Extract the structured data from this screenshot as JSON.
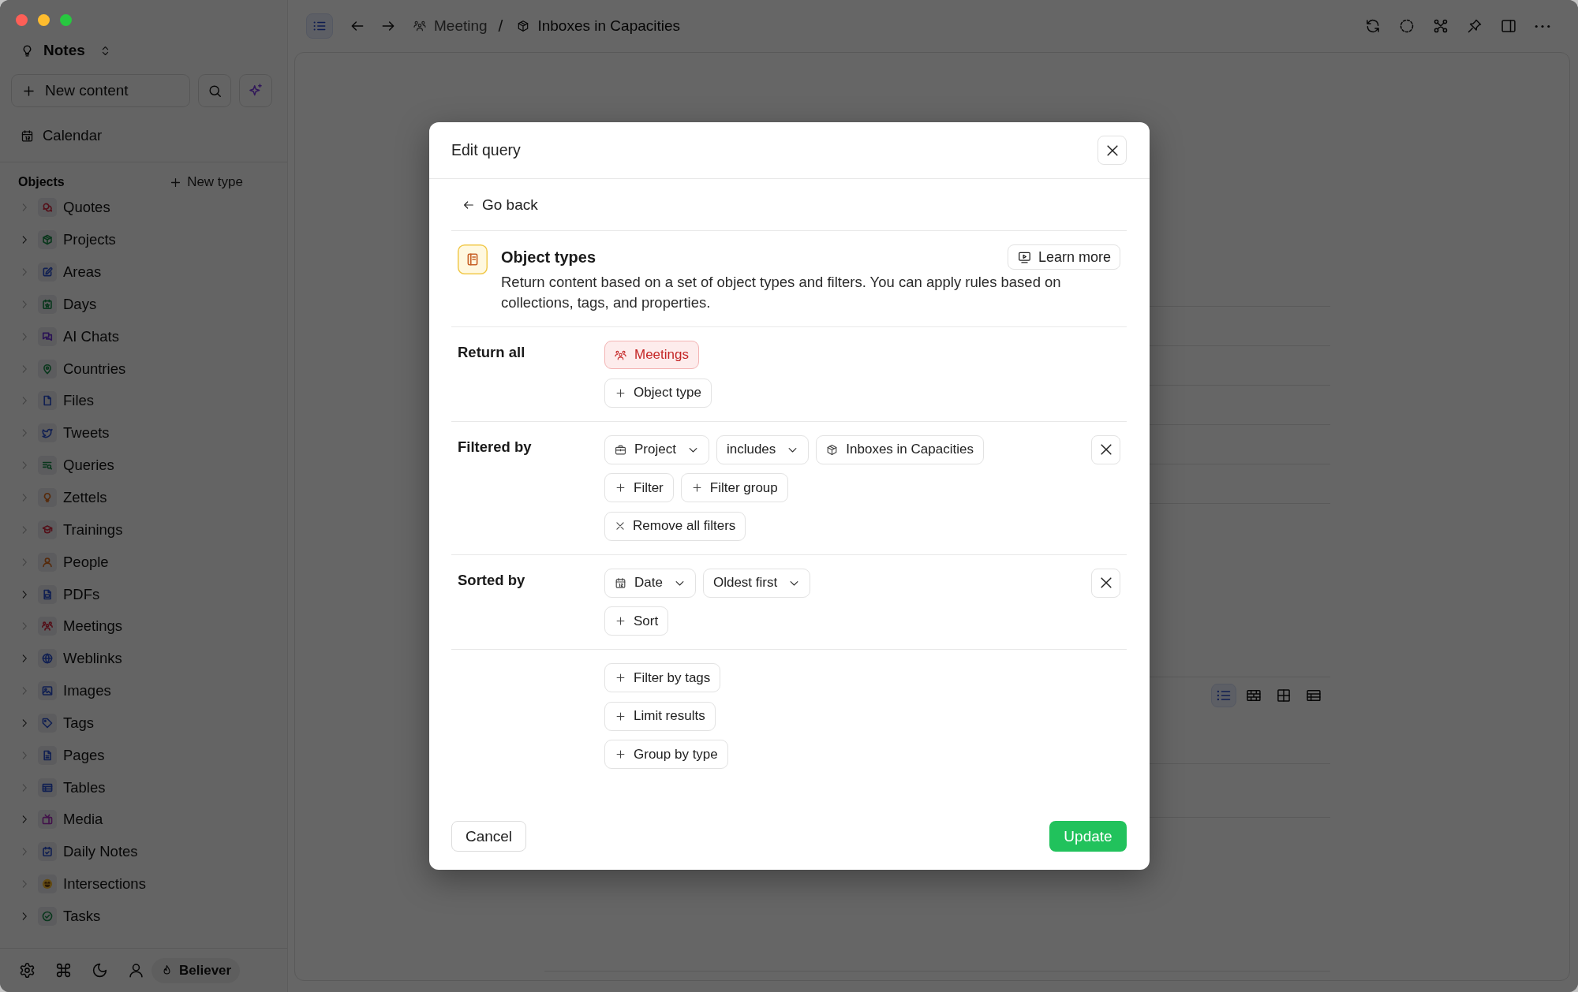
{
  "sidebar": {
    "space": {
      "name": "Notes"
    },
    "new_content": "New content",
    "calendar": "Calendar",
    "objects": {
      "heading": "Objects",
      "new_type": "New type",
      "items": [
        {
          "label": "Quotes",
          "expandable": false
        },
        {
          "label": "Projects",
          "expandable": true
        },
        {
          "label": "Areas",
          "expandable": false
        },
        {
          "label": "Days",
          "expandable": false
        },
        {
          "label": "AI Chats",
          "expandable": false
        },
        {
          "label": "Countries",
          "expandable": false
        },
        {
          "label": "Files",
          "expandable": false
        },
        {
          "label": "Tweets",
          "expandable": false
        },
        {
          "label": "Queries",
          "expandable": false
        },
        {
          "label": "Zettels",
          "expandable": false
        },
        {
          "label": "Trainings",
          "expandable": false
        },
        {
          "label": "People",
          "expandable": false
        },
        {
          "label": "PDFs",
          "expandable": true
        },
        {
          "label": "Meetings",
          "expandable": false
        },
        {
          "label": "Weblinks",
          "expandable": true
        },
        {
          "label": "Images",
          "expandable": false
        },
        {
          "label": "Tags",
          "expandable": true
        },
        {
          "label": "Pages",
          "expandable": false
        },
        {
          "label": "Tables",
          "expandable": false
        },
        {
          "label": "Media",
          "expandable": true
        },
        {
          "label": "Daily Notes",
          "expandable": false
        },
        {
          "label": "Intersections",
          "expandable": false
        },
        {
          "label": "Tasks",
          "expandable": true
        }
      ]
    },
    "footer": {
      "plan": "Believer"
    }
  },
  "toolbar": {
    "sidebar_toggle": {
      "on": true
    },
    "breadcrumbs": [
      {
        "label": "Meeting",
        "current": false
      },
      {
        "label": "Inboxes in Capacities",
        "current": true
      }
    ],
    "separator": "/"
  },
  "content": {
    "views": [
      {
        "selected": true
      },
      {
        "selected": false
      },
      {
        "selected": false
      },
      {
        "selected": false
      }
    ]
  },
  "dialog": {
    "title": "Edit query",
    "back": "Go back",
    "intro": {
      "title": "Object types",
      "description": "Return content based on a set of object types and filters. You can apply rules based on collections, tags, and properties.",
      "learn_more": "Learn more"
    },
    "sections": [
      {
        "label": "Return all",
        "removable": false,
        "rows": [
          [
            {
              "kind": "type",
              "label": "Meetings"
            }
          ],
          [
            {
              "kind": "add",
              "label": "Object type"
            }
          ]
        ]
      },
      {
        "label": "Filtered by",
        "removable": true,
        "rows": [
          [
            {
              "kind": "relation_property",
              "label": "Project"
            },
            {
              "kind": "select",
              "label": "includes"
            },
            {
              "kind": "value",
              "label": "Inboxes in Capacities"
            }
          ],
          [
            {
              "kind": "add",
              "label": "Filter"
            },
            {
              "kind": "add",
              "label": "Filter group"
            }
          ],
          [
            {
              "kind": "clear",
              "label": "Remove all filters"
            }
          ]
        ]
      },
      {
        "label": "Sorted by",
        "removable": true,
        "rows": [
          [
            {
              "kind": "date_property",
              "label": "Date"
            },
            {
              "kind": "select",
              "label": "Oldest first"
            }
          ],
          [
            {
              "kind": "add",
              "label": "Sort"
            }
          ]
        ]
      },
      {
        "removable": false,
        "rows": [
          [
            {
              "kind": "add",
              "label": "Filter by tags"
            }
          ],
          [
            {
              "kind": "add",
              "label": "Limit results"
            }
          ],
          [
            {
              "kind": "add",
              "label": "Group by type"
            }
          ]
        ]
      }
    ],
    "cancel": "Cancel",
    "submit": "Update"
  }
}
